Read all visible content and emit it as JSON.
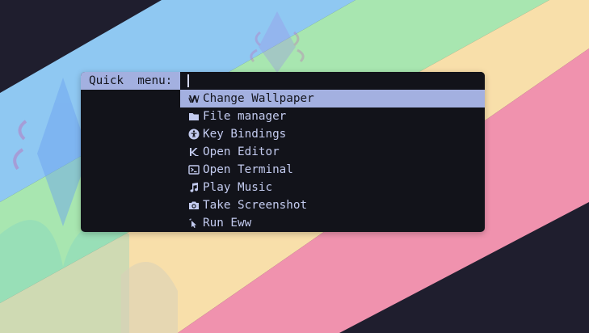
{
  "colors": {
    "desktop_dark": "#1f1e2e",
    "stripe_blue": "#8fc8f2",
    "stripe_green": "#a8e6b0",
    "stripe_yellow": "#f8dfaa",
    "stripe_pink": "#f092ae",
    "menu_background": "#12131a",
    "selection": "#a3b0e0",
    "text": "#c3cbef"
  },
  "menu": {
    "prompt": "Quick  menu:",
    "query": "",
    "items": [
      {
        "label": "Change Wallpaper",
        "icon": "wallpaper-icon",
        "selected": true
      },
      {
        "label": "File manager",
        "icon": "folder-icon",
        "selected": false
      },
      {
        "label": "Key Bindings",
        "icon": "accessibility-icon",
        "selected": false
      },
      {
        "label": "Open Editor",
        "icon": "editor-icon",
        "selected": false
      },
      {
        "label": "Open Terminal",
        "icon": "terminal-icon",
        "selected": false
      },
      {
        "label": "Play Music",
        "icon": "music-note-icon",
        "selected": false
      },
      {
        "label": "Take Screenshot",
        "icon": "camera-icon",
        "selected": false
      },
      {
        "label": "Run Eww",
        "icon": "pointer-icon",
        "selected": false
      }
    ]
  }
}
